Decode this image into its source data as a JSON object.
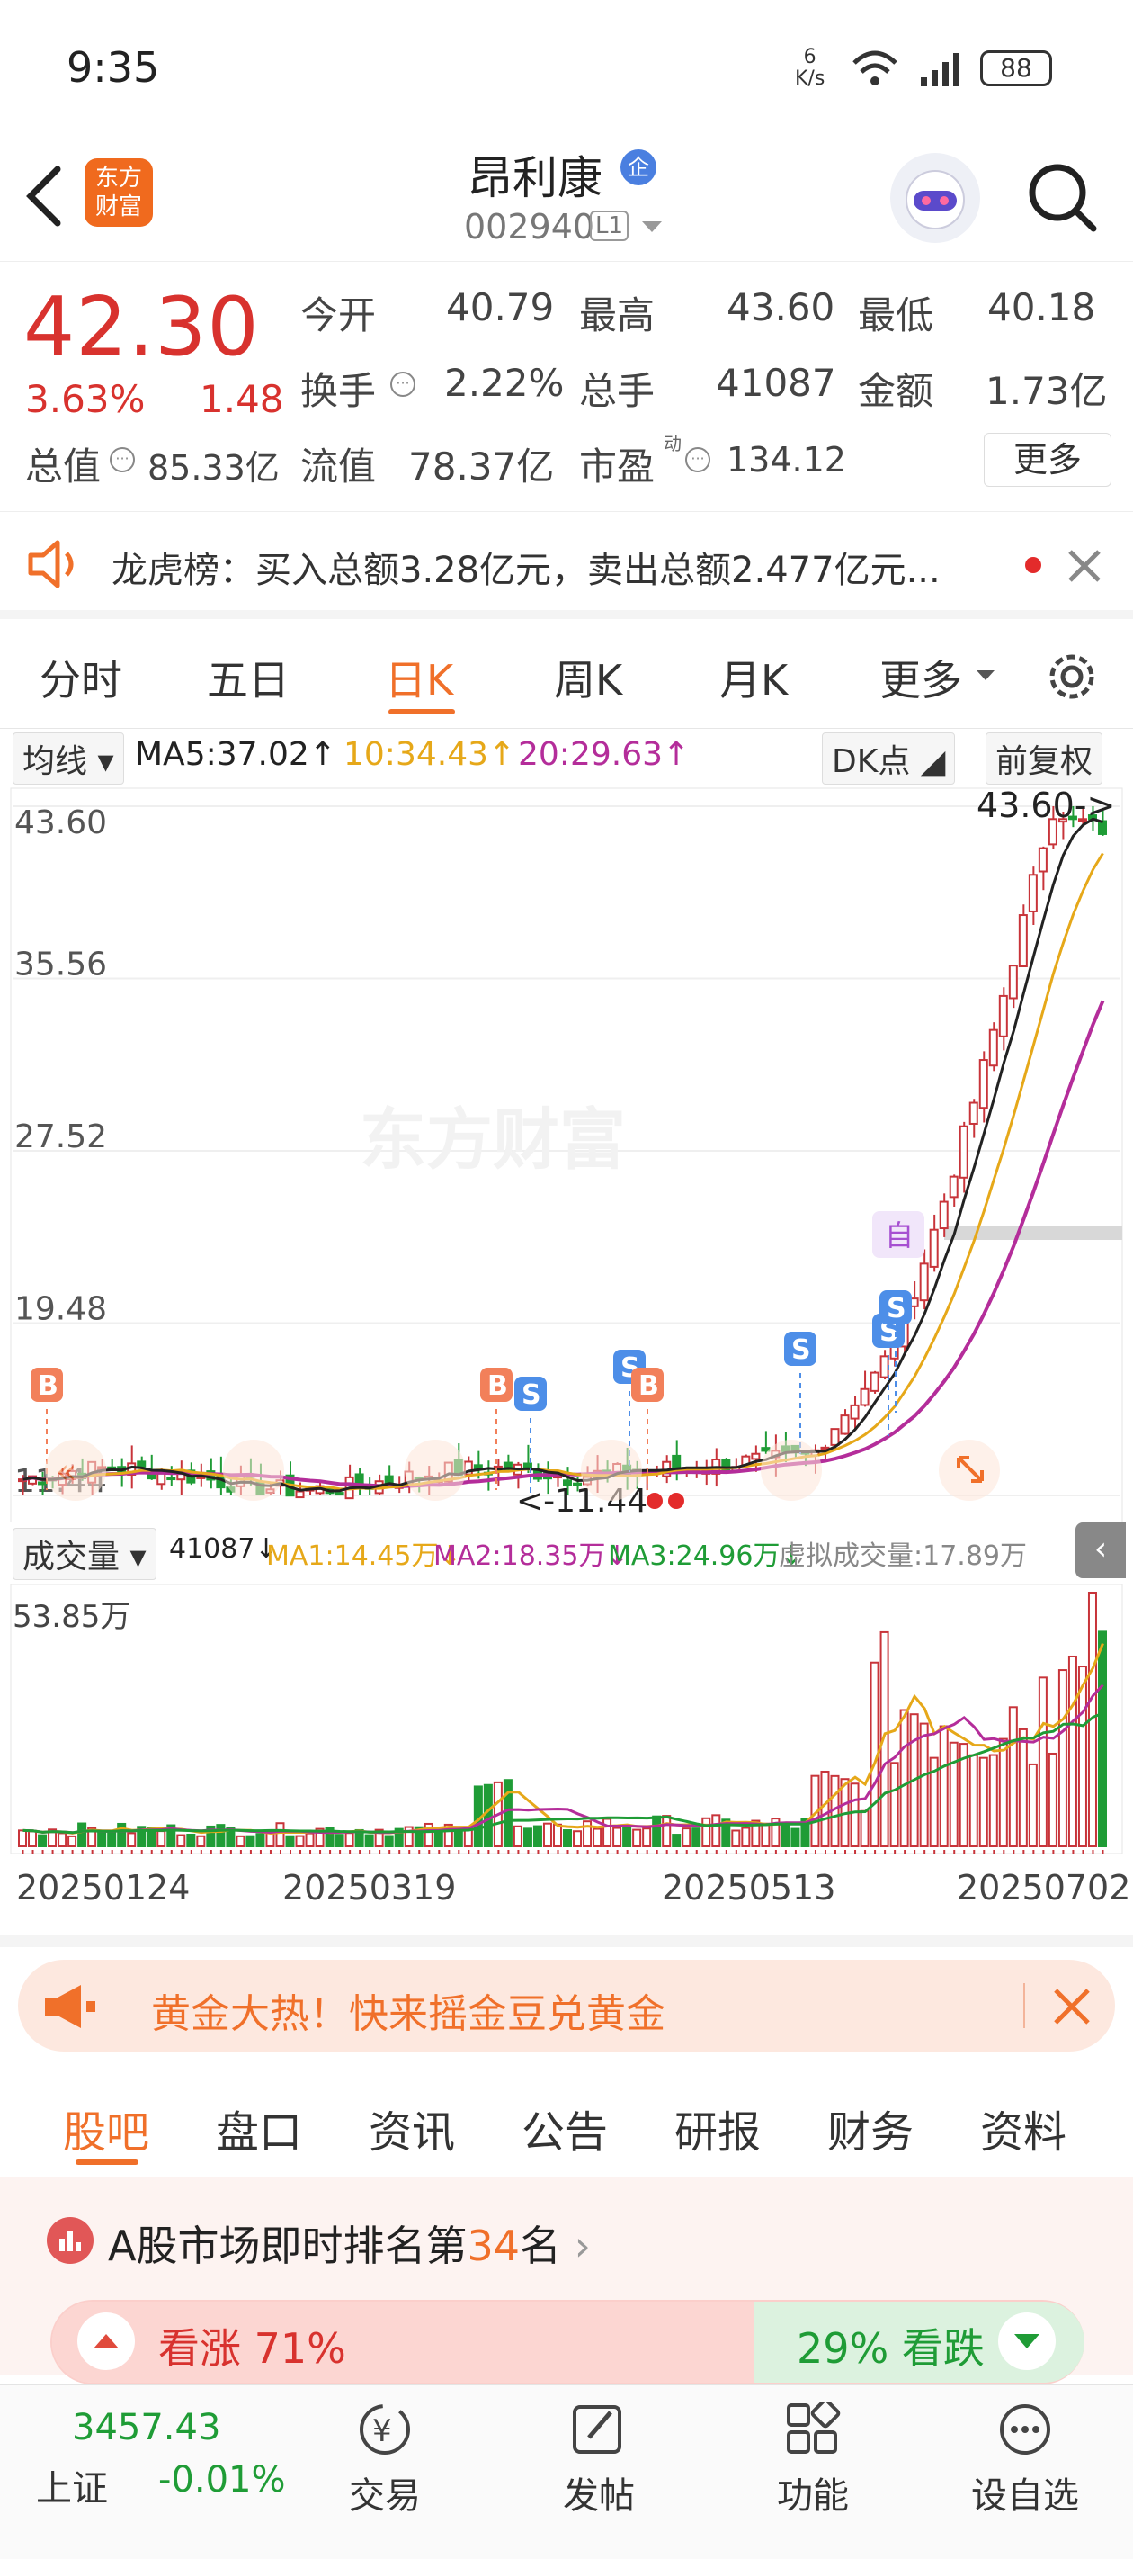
{
  "status": {
    "time": "9:35",
    "net": "6\nK/s",
    "net_top": "6",
    "net_bot": "K/s",
    "battery": "88"
  },
  "header": {
    "logo_line1": "东方",
    "logo_line2": "财富",
    "name": "昂利康",
    "code": "002940",
    "level": "L1"
  },
  "quote": {
    "price": "42.30",
    "pct": "3.63%",
    "chg": "1.48",
    "open_label": "今开",
    "open": "40.79",
    "high_label": "最高",
    "high": "43.60",
    "low_label": "最低",
    "low": "40.18",
    "turnover_label": "换手",
    "turnover": "2.22%",
    "vol_label": "总手",
    "vol": "41087",
    "amt_label": "金额",
    "amt": "1.73亿",
    "mcap_label": "总值",
    "mcap": "85.33亿",
    "float_label": "流值",
    "float": "78.37亿",
    "pe_label": "市盈",
    "pe_sup": "动",
    "pe": "134.12",
    "more": "更多"
  },
  "news": {
    "text": "龙虎榜：买入总额3.28亿元，卖出总额2.477亿元..."
  },
  "tabs": [
    "分时",
    "五日",
    "日K",
    "周K",
    "月K",
    "更多"
  ],
  "chart_hdr": {
    "ma_select": "均线",
    "ma5": "MA5:37.02↑",
    "ma10": "10:34.43↑",
    "ma20": "20:29.63↑",
    "dk": "DK点",
    "fq": "前复权"
  },
  "kchart": {
    "yticks": [
      "43.60",
      "35.56",
      "27.52",
      "19.48",
      "11.44"
    ],
    "max_label": "43.60->",
    "min_label": "<-11.44",
    "watermark": "东方财富",
    "self_mark": "自",
    "buy": "B",
    "sell": "S"
  },
  "vol_hdr": {
    "select": "成交量",
    "vol": "41087↓",
    "ma1": "MA1:14.45万↓",
    "ma2": "MA2:18.35万↓",
    "ma3": "MA3:24.96万↓",
    "virtual": "虚拟成交量:17.89万",
    "max": "53.85万"
  },
  "dates": [
    "20250124",
    "20250319",
    "20250513",
    "20250702"
  ],
  "chart_data": {
    "type": "candlestick",
    "ylim": [
      11.44,
      43.6
    ],
    "high": 43.6,
    "low": 11.44,
    "last": 42.3,
    "ma5": 37.02,
    "ma10": 34.43,
    "ma20": 29.63
  },
  "banner": {
    "text": "黄金大热！快来摇金豆兑黄金"
  },
  "tabs2": [
    "股吧",
    "盘口",
    "资讯",
    "公告",
    "研报",
    "财务",
    "资料"
  ],
  "rank": {
    "pre": "A股市场即时排名第",
    "num": "34",
    "post": "名",
    "up": "看涨 71%",
    "down": "29% 看跌"
  },
  "bottom": {
    "index_val": "3457.43",
    "index_name": "上证",
    "index_chg": "-0.01%",
    "trade": "交易",
    "post": "发帖",
    "func": "功能",
    "fav": "设自选"
  },
  "colors": {
    "red": "#d8322e",
    "green": "#1f9c36",
    "accent": "#f0702a"
  }
}
